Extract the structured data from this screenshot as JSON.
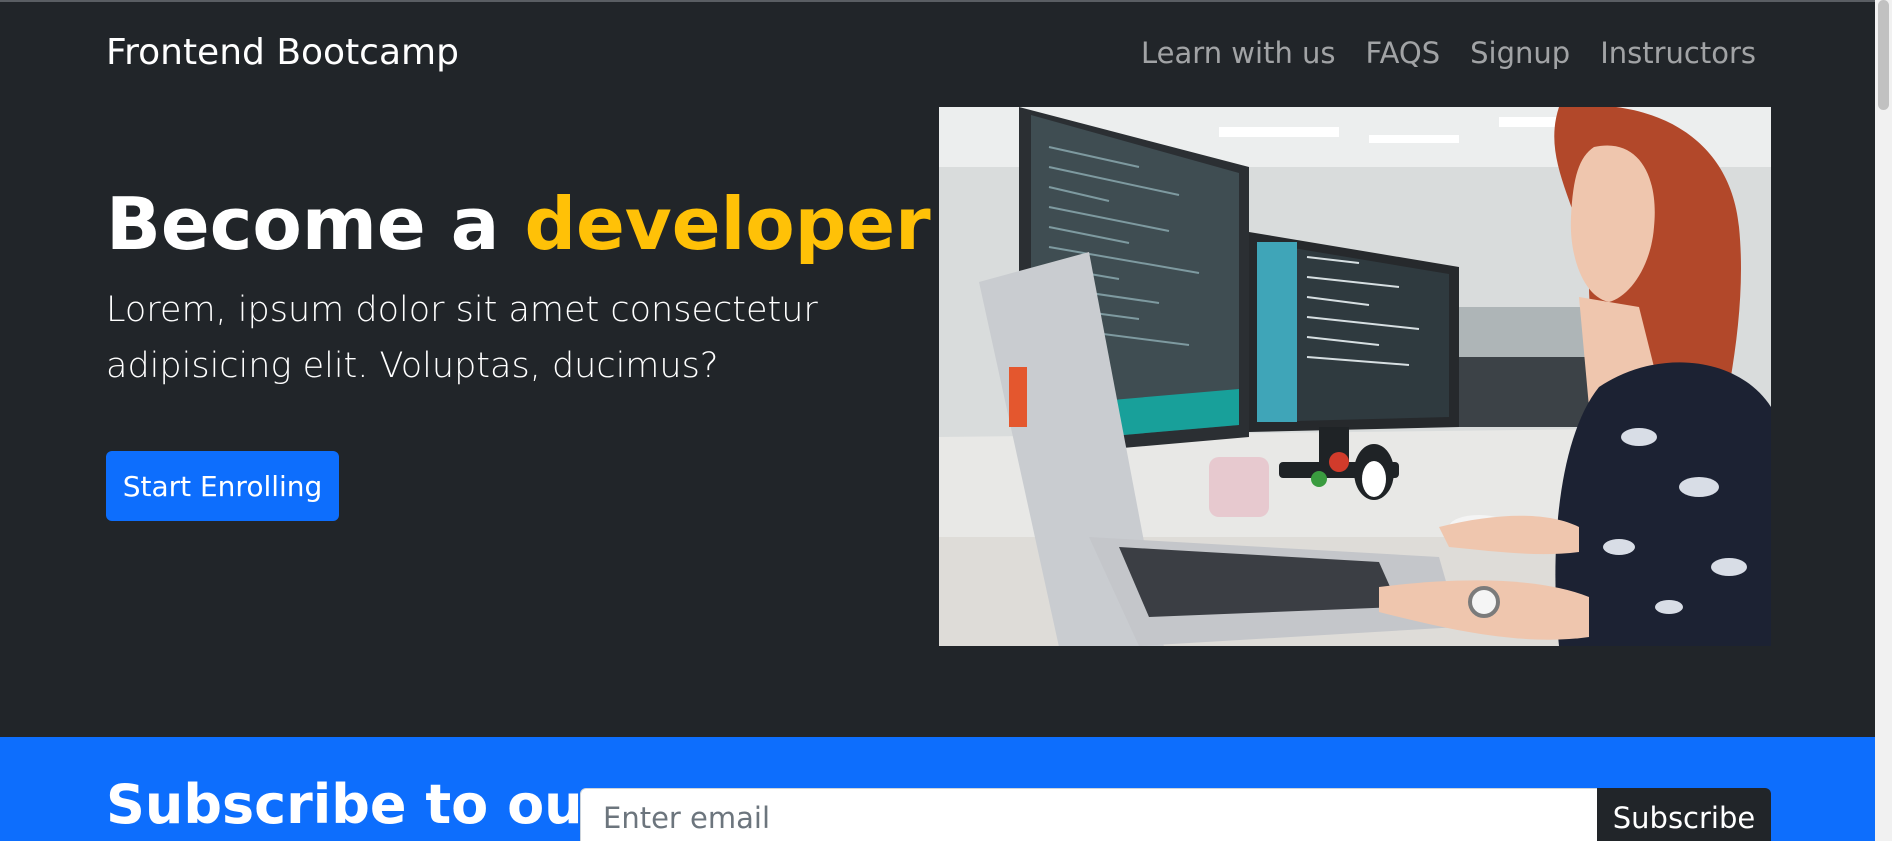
{
  "navbar": {
    "brand": "Frontend Bootcamp",
    "links": [
      "Learn with us",
      "FAQS",
      "Signup",
      "Instructors"
    ]
  },
  "hero": {
    "title_prefix": "Become a ",
    "title_accent": "developer",
    "lead": "Lorem, ipsum dolor sit amet consectetur adipisicing elit. Voluptas, ducimus?",
    "button_label": "Start Enrolling",
    "image_alt": "developer at workstation"
  },
  "newsletter": {
    "title": "Subscribe to our",
    "email_placeholder": "Enter email",
    "button_label": "Subscribe"
  },
  "colors": {
    "background": "#212529",
    "accent": "#ffc107",
    "primary": "#0d6efd"
  }
}
